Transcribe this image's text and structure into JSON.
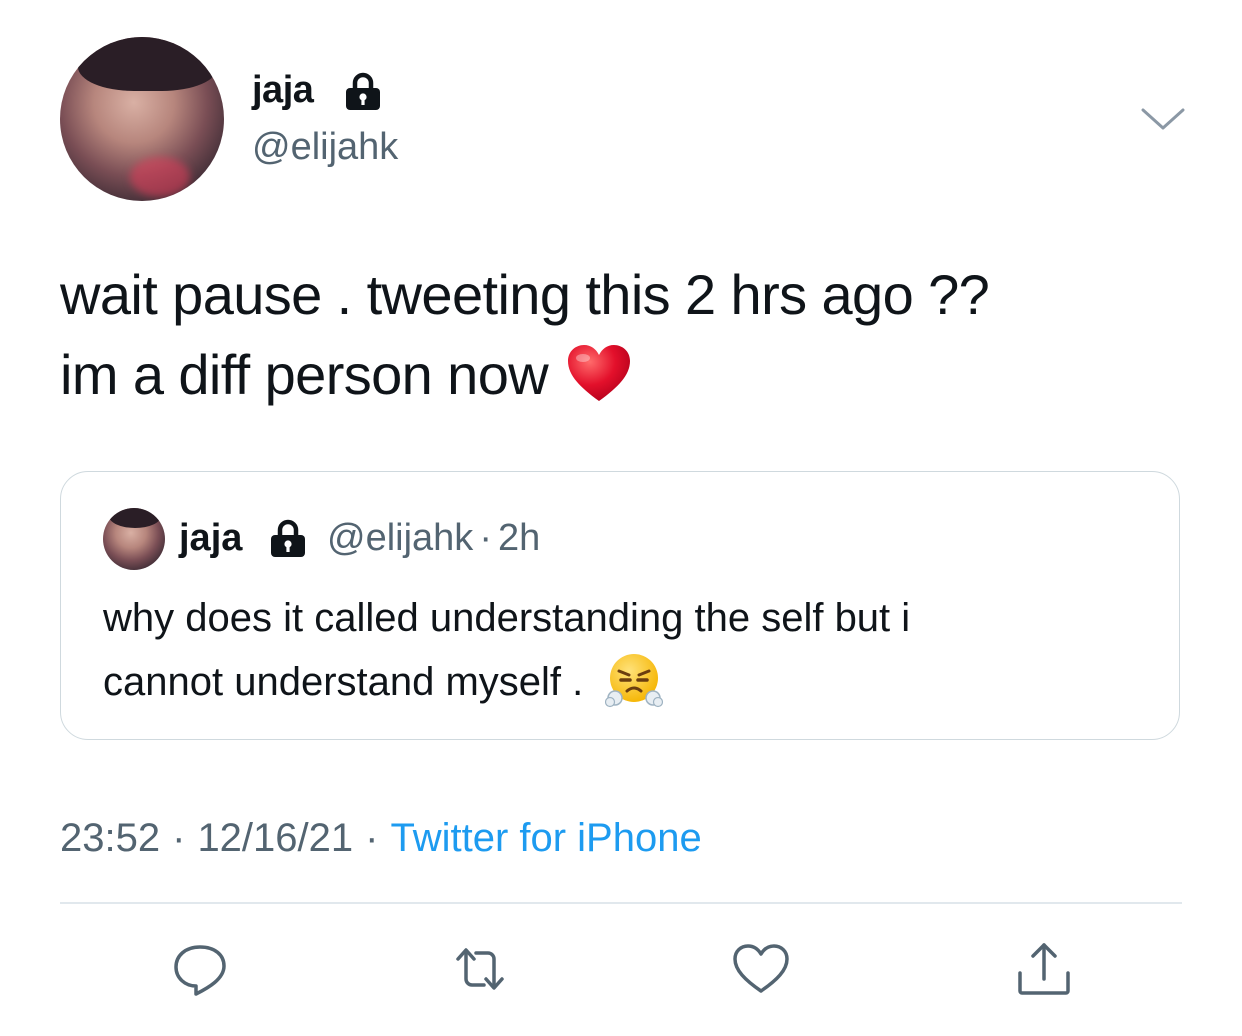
{
  "tweet": {
    "author": {
      "display_name": "jaja",
      "handle": "@elijahk",
      "protected_icon": "lock-icon"
    },
    "text_lines": [
      "wait pause . tweeting this 2 hrs ago ??",
      "im a diff person now"
    ],
    "text_emoji": "red-heart",
    "quote": {
      "display_name": "jaja",
      "handle": "@elijahk",
      "separator": "·",
      "time": "2h",
      "text_lines": [
        "why does it called understanding the self but i",
        "cannot understand myself ."
      ],
      "text_emoji": "face-with-steam-from-nose"
    },
    "meta": {
      "time": "23:52",
      "separator": "·",
      "date": "12/16/21",
      "source": "Twitter for iPhone"
    },
    "actions": [
      {
        "icon": "reply-icon"
      },
      {
        "icon": "retweet-icon"
      },
      {
        "icon": "like-icon"
      },
      {
        "icon": "share-icon"
      }
    ]
  },
  "colors": {
    "text": "#0f1419",
    "secondary": "#536471",
    "link": "#1d9bf0",
    "border": "#cfd9de",
    "divider": "#e1e8ed",
    "icon": "#536471"
  }
}
